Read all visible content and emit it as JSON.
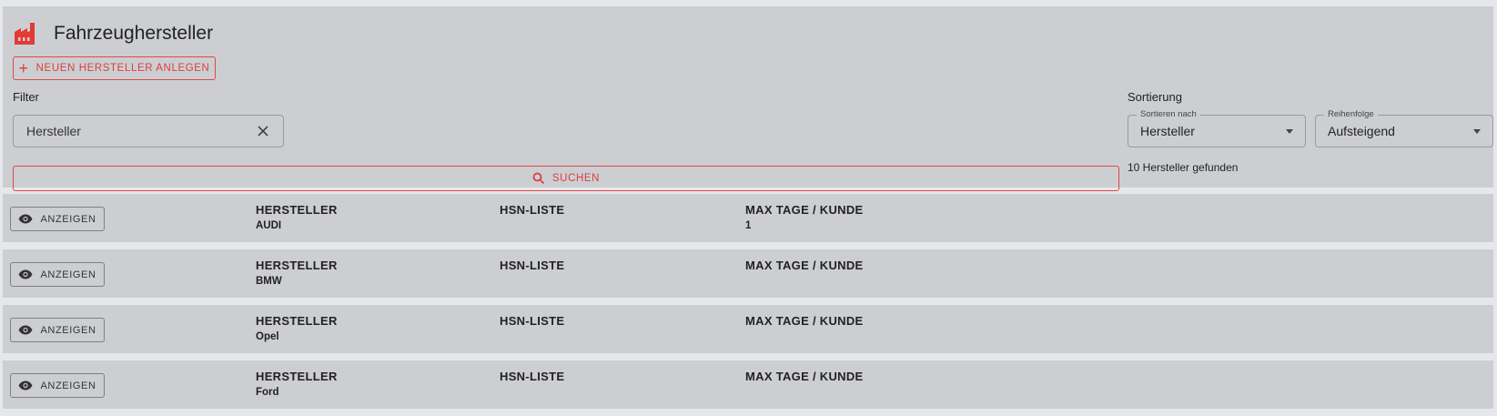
{
  "header": {
    "title": "Fahrzeughersteller",
    "icon": "factory-icon",
    "accent_color": "#e53935"
  },
  "actions": {
    "new_label": "NEUEN HERSTELLER ANLEGEN",
    "search_label": "SUCHEN"
  },
  "filter": {
    "label": "Filter",
    "value": "Hersteller"
  },
  "sort": {
    "label": "Sortierung",
    "field_label": "Sortieren nach",
    "field_value": "Hersteller",
    "order_label": "Reihenfolge",
    "order_value": "Aufsteigend"
  },
  "result_count": "10 Hersteller gefunden",
  "columns": {
    "manufacturer": "HERSTELLER",
    "hsn": "HSN-LISTE",
    "max_days": "MAX TAGE / KUNDE"
  },
  "view_label": "ANZEIGEN",
  "rows": [
    {
      "manufacturer": "AUDI",
      "hsn": "",
      "max_days": "1"
    },
    {
      "manufacturer": "BMW",
      "hsn": "",
      "max_days": ""
    },
    {
      "manufacturer": "Opel",
      "hsn": "",
      "max_days": ""
    },
    {
      "manufacturer": "Ford",
      "hsn": "",
      "max_days": ""
    }
  ]
}
